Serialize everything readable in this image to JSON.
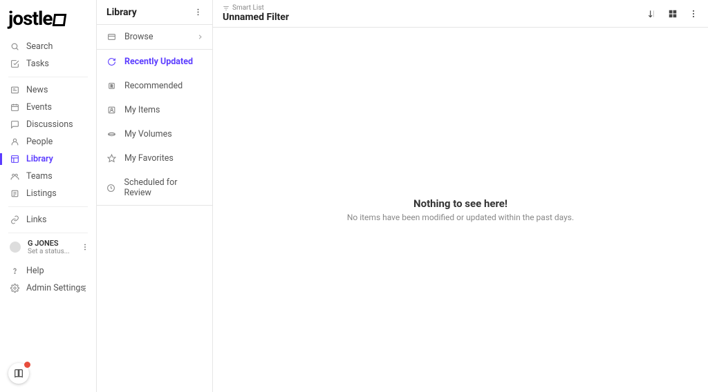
{
  "logo": "jostle",
  "leftnav": {
    "search": "Search",
    "tasks": "Tasks",
    "news": "News",
    "events": "Events",
    "discussions": "Discussions",
    "people": "People",
    "library": "Library",
    "teams": "Teams",
    "listings": "Listings",
    "links": "Links",
    "help": "Help",
    "admin": "Admin Settings"
  },
  "user": {
    "name": "G JONES",
    "status": "Set a status..."
  },
  "midpanel": {
    "title": "Library",
    "browse": "Browse",
    "recently_updated": "Recently Updated",
    "recommended": "Recommended",
    "my_items": "My Items",
    "my_volumes": "My Volumes",
    "my_favorites": "My Favorites",
    "scheduled": "Scheduled for Review"
  },
  "main": {
    "smart_list": "Smart List",
    "filter_title": "Unnamed Filter",
    "empty_title": "Nothing to see here!",
    "empty_sub": "No items have been modified or updated within the past days."
  }
}
